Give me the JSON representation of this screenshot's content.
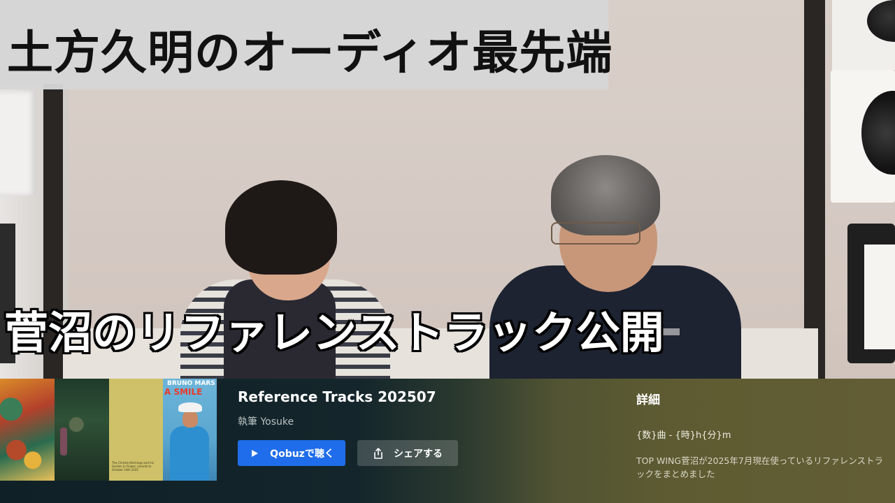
{
  "overlay": {
    "title": "土方久明のオーディオ最先端",
    "subtitle": "菅沼のリファレンストラック公開"
  },
  "playlist": {
    "title": "Reference Tracks 202507",
    "author": "執筆 Yosuke",
    "covers": {
      "cover4_artist": "BRUNO MARS",
      "cover4_album": "A SMILE",
      "cover3_text": "The Christie Hitchings and his Garden In Flower. Lorentz to October 14th 2025"
    },
    "buttons": {
      "listen_label": "Qobuzで聴く",
      "share_label": "シェアする"
    },
    "details": {
      "heading": "詳細",
      "meta": "{数}曲 - {時}h{分}m",
      "description": "TOP WING菅沼が2025年7月現在使っているリファレンストラックをまとめました"
    }
  },
  "icons": {
    "play": "play-icon",
    "share": "share-icon"
  },
  "colors": {
    "qobuz_button": "#1f6dea",
    "title_bar": "#d6d6d6"
  }
}
